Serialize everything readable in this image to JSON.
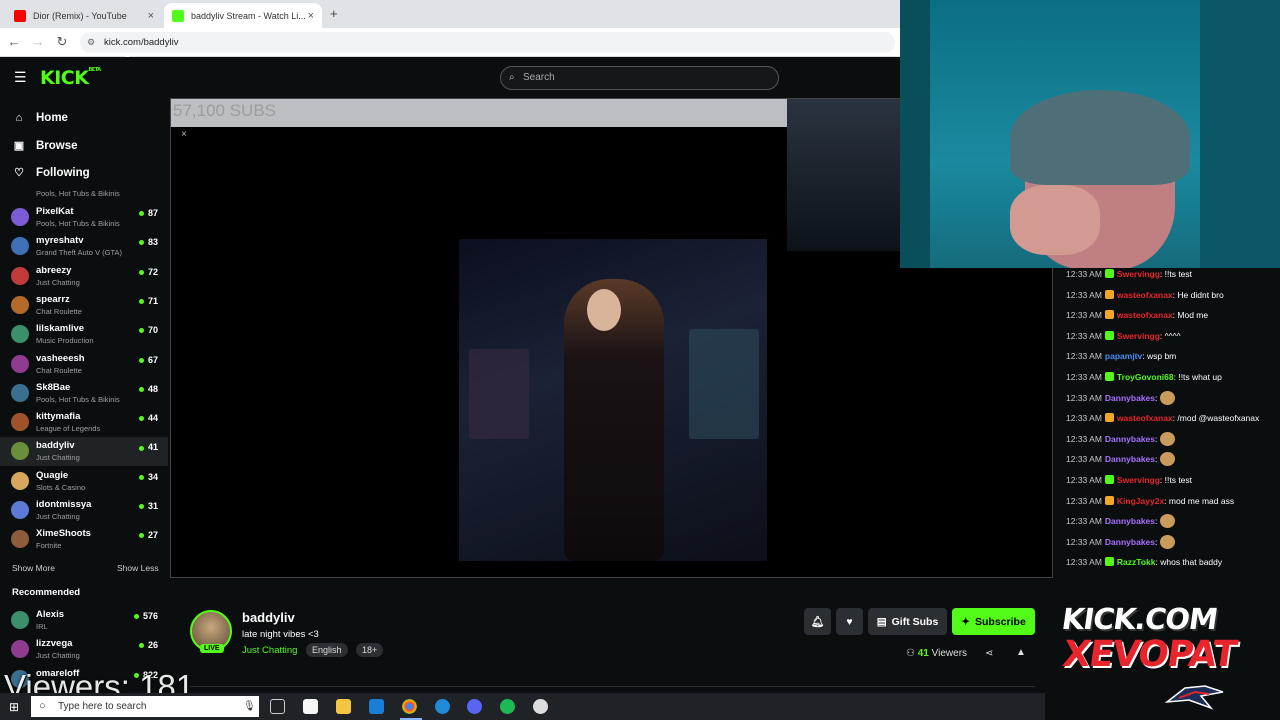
{
  "browser": {
    "tabs": [
      {
        "title": "Dior (Remix) - YouTube",
        "favicon": "youtube-icon",
        "color": "#ff0000",
        "active": false
      },
      {
        "title": "baddyliv Stream - Watch Li...",
        "favicon": "kick-icon",
        "color": "#53fc18",
        "active": true
      }
    ],
    "new_tab": "+",
    "close": "×",
    "url": "kick.com/baddyliv"
  },
  "kick": {
    "logo": "KICK",
    "logo_badge": "BETA",
    "search_placeholder": "Search",
    "accent": "#53fc18"
  },
  "sidebar": {
    "nav": [
      {
        "label": "Home",
        "icon": "home-icon"
      },
      {
        "label": "Browse",
        "icon": "browse-icon"
      },
      {
        "label": "Following",
        "icon": "heart-icon"
      }
    ],
    "clipped_category": "Pools, Hot Tubs & Bikinis",
    "following": [
      {
        "name": "PixelKat",
        "category": "Pools, Hot Tubs & Bikinis",
        "viewers": "87"
      },
      {
        "name": "myreshatv",
        "category": "Grand Theft Auto V (GTA)",
        "viewers": "83"
      },
      {
        "name": "abreezy",
        "category": "Just Chatting",
        "viewers": "72"
      },
      {
        "name": "spearrz",
        "category": "Chat Roulette",
        "viewers": "71"
      },
      {
        "name": "lilskamlive",
        "category": "Music Production",
        "viewers": "70"
      },
      {
        "name": "vasheeesh",
        "category": "Chat Roulette",
        "viewers": "67"
      },
      {
        "name": "Sk8Bae",
        "category": "Pools, Hot Tubs & Bikinis",
        "viewers": "48"
      },
      {
        "name": "kittymafia",
        "category": "League of Legends",
        "viewers": "44"
      },
      {
        "name": "baddyliv",
        "category": "Just Chatting",
        "viewers": "41"
      },
      {
        "name": "Quagie",
        "category": "Slots & Casino",
        "viewers": "34"
      },
      {
        "name": "idontmissya",
        "category": "Just Chatting",
        "viewers": "31"
      },
      {
        "name": "XimeShoots",
        "category": "Fortnite",
        "viewers": "27"
      }
    ],
    "show_more": "Show More",
    "show_less": "Show Less",
    "recommended_title": "Recommended",
    "recommended": [
      {
        "name": "Alexis",
        "category": "IRL",
        "viewers": "576"
      },
      {
        "name": "lizzvega",
        "category": "Just Chatting",
        "viewers": "26"
      },
      {
        "name": "omareloff",
        "category": "",
        "viewers": "822"
      }
    ]
  },
  "video": {
    "overlay_text": "57,100 SUBS",
    "close": "×"
  },
  "chat": {
    "messages": [
      {
        "time": "12:33 AM",
        "user": "Swervingg",
        "user_color": "#e8242c",
        "badge": "#53fc18",
        "text": ": !!ts test"
      },
      {
        "time": "12:33 AM",
        "user": "wasteofxanax",
        "user_color": "#e8242c",
        "badge": "#f5a623",
        "text": ": He didnt bro"
      },
      {
        "time": "12:33 AM",
        "user": "wasteofxanax",
        "user_color": "#e8242c",
        "badge": "#f5a623",
        "text": ": Mod me"
      },
      {
        "time": "12:33 AM",
        "user": "Swervingg",
        "user_color": "#e8242c",
        "badge": "#53fc18",
        "text": ": ^^^^"
      },
      {
        "time": "12:33 AM",
        "user": "papamjtv",
        "user_color": "#4b8df8",
        "badge": "",
        "text": ": wsp bm"
      },
      {
        "time": "12:33 AM",
        "user": "TroyGovoni68",
        "user_color": "#53fc18",
        "badge": "#53fc18",
        "text": ": !!ts what up"
      },
      {
        "time": "12:33 AM",
        "user": "Dannybakes",
        "user_color": "#a970ff",
        "badge": "",
        "text": ":",
        "emote": true
      },
      {
        "time": "12:33 AM",
        "user": "wasteofxanax",
        "user_color": "#e8242c",
        "badge": "#f5a623",
        "text": ": /mod @wasteofxanax"
      },
      {
        "time": "12:33 AM",
        "user": "Dannybakes",
        "user_color": "#a970ff",
        "badge": "",
        "text": ":",
        "emote": true
      },
      {
        "time": "12:33 AM",
        "user": "Dannybakes",
        "user_color": "#a970ff",
        "badge": "",
        "text": ":",
        "emote": true
      },
      {
        "time": "12:33 AM",
        "user": "Swervingg",
        "user_color": "#e8242c",
        "badge": "#53fc18",
        "text": ": !!ts test"
      },
      {
        "time": "12:33 AM",
        "user": "KingJayy2x",
        "user_color": "#e8242c",
        "badge": "#f5a623",
        "text": ": mod me mad ass"
      },
      {
        "time": "12:33 AM",
        "user": "Dannybakes",
        "user_color": "#a970ff",
        "badge": "",
        "text": ":",
        "emote": true
      },
      {
        "time": "12:33 AM",
        "user": "Dannybakes",
        "user_color": "#a970ff",
        "badge": "",
        "text": ":",
        "emote": true
      },
      {
        "time": "12:33 AM",
        "user": "RazzTokk",
        "user_color": "#53fc18",
        "badge": "#53fc18",
        "text": ": whos that baddy"
      }
    ]
  },
  "channel": {
    "name": "baddyliv",
    "live": "LIVE",
    "title": "late night vibes <3",
    "category": "Just Chatting",
    "tags": [
      "English",
      "18+"
    ],
    "gift_subs": "Gift Subs",
    "subscribe": "Subscribe",
    "viewers_count": "41",
    "viewers_label": "Viewers"
  },
  "overlay": {
    "viewers_text": "Viewers: 181",
    "brand_line1": "KICK.COM",
    "brand_line2": "XEVOPAT"
  },
  "taskbar": {
    "search_placeholder": "Type here to search"
  }
}
